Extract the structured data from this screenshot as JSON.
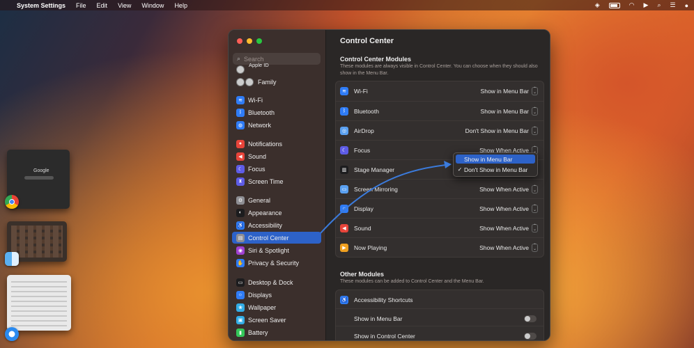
{
  "menubar": {
    "apple": "",
    "app": "System Settings",
    "menus": [
      "File",
      "Edit",
      "View",
      "Window",
      "Help"
    ]
  },
  "window": {
    "search_placeholder": "Search",
    "sidebar": [
      {
        "label": "Apple ID",
        "icon": "avatar-icon",
        "color": "#cccccc"
      },
      {
        "label": "Family",
        "icon": "family-icon",
        "color": "#cccccc"
      },
      {
        "label": "Wi-Fi",
        "icon": "wifi-icon",
        "color": "#2f7cf6"
      },
      {
        "label": "Bluetooth",
        "icon": "bluetooth-icon",
        "color": "#2f7cf6"
      },
      {
        "label": "Network",
        "icon": "globe-icon",
        "color": "#2f7cf6"
      },
      {
        "label": "Notifications",
        "icon": "bell-icon",
        "color": "#e8443a"
      },
      {
        "label": "Sound",
        "icon": "speaker-icon",
        "color": "#e8443a"
      },
      {
        "label": "Focus",
        "icon": "moon-icon",
        "color": "#5e5ce6"
      },
      {
        "label": "Screen Time",
        "icon": "hourglass-icon",
        "color": "#5e5ce6"
      },
      {
        "label": "General",
        "icon": "gear-icon",
        "color": "#8e8e93"
      },
      {
        "label": "Appearance",
        "icon": "appearance-icon",
        "color": "#1c1c1e"
      },
      {
        "label": "Accessibility",
        "icon": "accessibility-icon",
        "color": "#2f7cf6"
      },
      {
        "label": "Control Center",
        "icon": "control-center-icon",
        "color": "#8e8e93"
      },
      {
        "label": "Siri & Spotlight",
        "icon": "siri-icon",
        "color": "#a040d0"
      },
      {
        "label": "Privacy & Security",
        "icon": "hand-icon",
        "color": "#2f7cf6"
      },
      {
        "label": "Desktop & Dock",
        "icon": "dock-icon",
        "color": "#1c1c1e"
      },
      {
        "label": "Displays",
        "icon": "display-icon",
        "color": "#2f7cf6"
      },
      {
        "label": "Wallpaper",
        "icon": "wallpaper-icon",
        "color": "#32ade6"
      },
      {
        "label": "Screen Saver",
        "icon": "screensaver-icon",
        "color": "#32ade6"
      },
      {
        "label": "Battery",
        "icon": "battery-icon",
        "color": "#34c759"
      }
    ],
    "selected_sidebar": "Control Center",
    "content": {
      "title": "Control Center",
      "modules_title": "Control Center Modules",
      "modules_desc": "These modules are always visible in Control Center. You can choose when they should also show in the Menu Bar.",
      "modules": [
        {
          "label": "Wi-Fi",
          "value": "Show in Menu Bar",
          "icon": "wifi-icon",
          "color": "#2f7cf6"
        },
        {
          "label": "Bluetooth",
          "value": "Show in Menu Bar",
          "icon": "bluetooth-icon",
          "color": "#2f7cf6"
        },
        {
          "label": "AirDrop",
          "value": "Don't Show in Menu Bar",
          "icon": "airdrop-icon",
          "color": "#5aa0f0"
        },
        {
          "label": "Focus",
          "value": "Show When Active",
          "icon": "moon-icon",
          "color": "#5e5ce6"
        },
        {
          "label": "Stage Manager",
          "value": "",
          "icon": "stage-manager-icon",
          "color": "#1c1c1e"
        },
        {
          "label": "Screen Mirroring",
          "value": "Show When Active",
          "icon": "mirroring-icon",
          "color": "#5aa0f0"
        },
        {
          "label": "Display",
          "value": "Show When Active",
          "icon": "brightness-icon",
          "color": "#2f7cf6"
        },
        {
          "label": "Sound",
          "value": "Show When Active",
          "icon": "speaker-icon",
          "color": "#e8443a"
        },
        {
          "label": "Now Playing",
          "value": "Show When Active",
          "icon": "play-icon",
          "color": "#f0a020"
        }
      ],
      "other_title": "Other Modules",
      "other_desc": "These modules can be added to Control Center and the Menu Bar.",
      "other_group_title": "Accessibility Shortcuts",
      "other_rows": [
        {
          "label": "Show in Menu Bar"
        },
        {
          "label": "Show in Control Center"
        }
      ]
    }
  },
  "dropdown": {
    "items": [
      {
        "label": "Show in Menu Bar",
        "checked": false,
        "highlighted": true
      },
      {
        "label": "Don't Show in Menu Bar",
        "checked": true,
        "highlighted": false
      }
    ]
  },
  "thumbnails": {
    "google_logo": "Google"
  },
  "colors": {
    "accent": "#2d62c8",
    "arrow": "#3b7bdc"
  }
}
